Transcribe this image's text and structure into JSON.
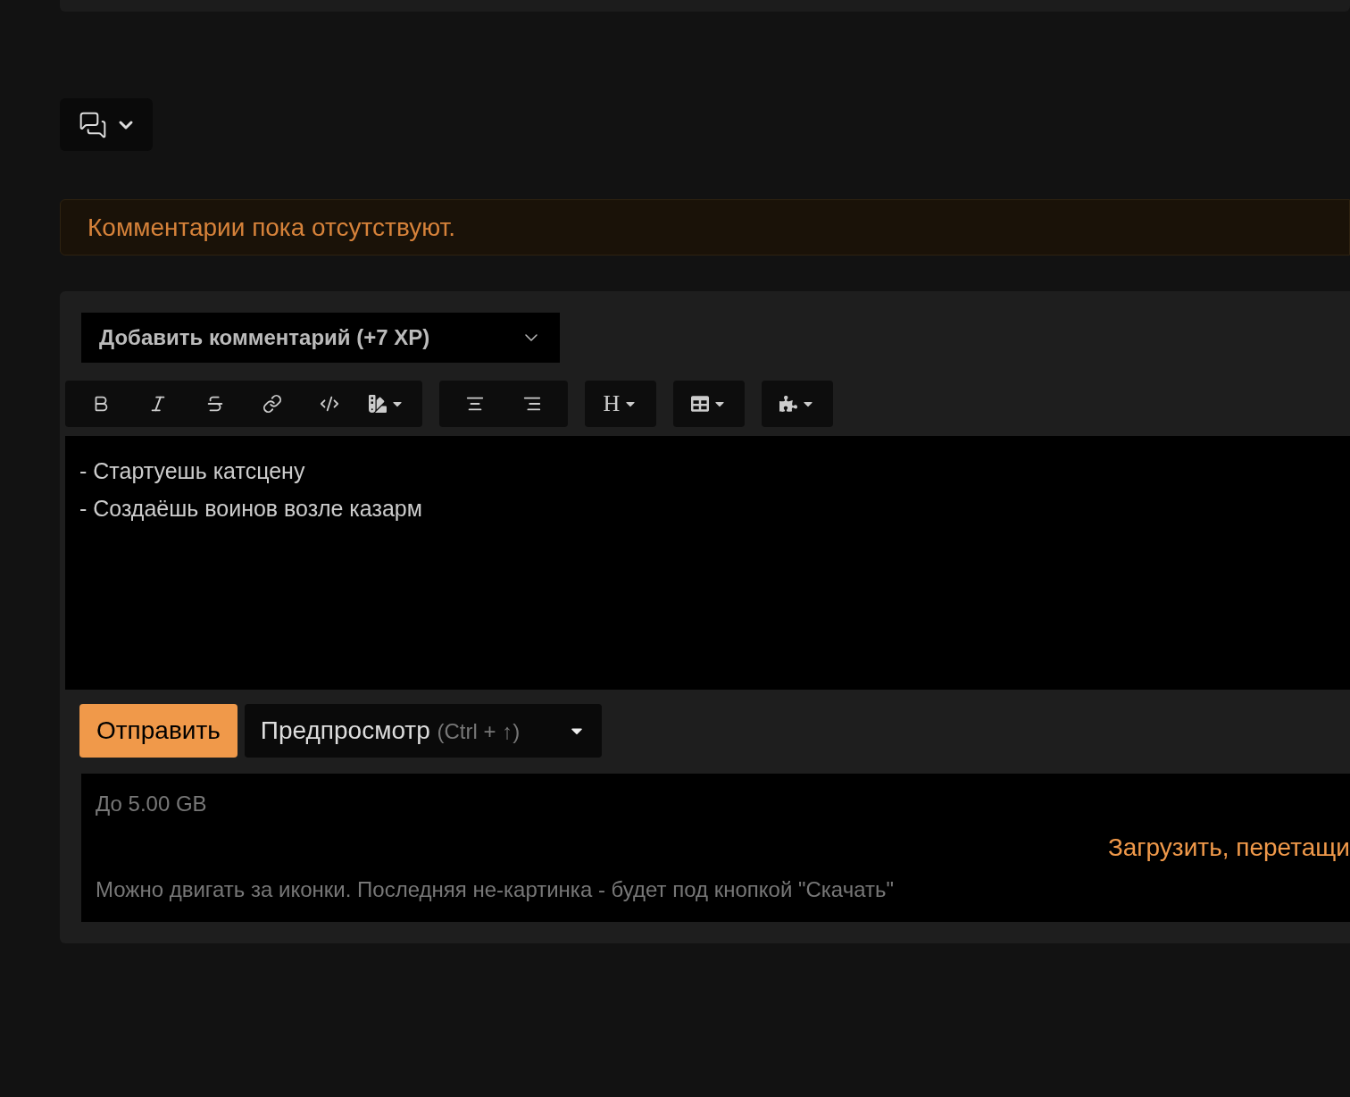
{
  "comments_toggle": {
    "menu": true
  },
  "notice": "Комментарии пока отсутствуют.",
  "form": {
    "mode_select": {
      "value": "Добавить комментарий (+7 XP)"
    },
    "toolbar": [
      {
        "buttons": [
          {
            "kind": "bold",
            "menu": false
          },
          {
            "kind": "italic",
            "menu": false
          },
          {
            "kind": "strike",
            "menu": false
          },
          {
            "kind": "link",
            "menu": false
          },
          {
            "kind": "code",
            "menu": false
          },
          {
            "kind": "color",
            "menu": true
          }
        ]
      },
      {
        "buttons": [
          {
            "kind": "center",
            "menu": false
          },
          {
            "kind": "right",
            "menu": false
          }
        ]
      },
      {
        "buttons": [
          {
            "kind": "heading",
            "label": "H",
            "menu": true
          }
        ]
      },
      {
        "buttons": [
          {
            "kind": "table",
            "menu": true
          }
        ]
      },
      {
        "buttons": [
          {
            "kind": "plugin",
            "menu": true
          }
        ]
      }
    ],
    "editor": {
      "lines": [
        "- Стартуешь катсцену",
        "- Создаёшь воинов возле казарм"
      ]
    },
    "submit": "Отправить",
    "preview": {
      "label": "Предпросмотр",
      "shortcut": "(Ctrl + ↑)",
      "menu": true
    },
    "upload": {
      "limit": "До 5.00 GB",
      "action": "Загрузить, перетащи",
      "hint": "Можно двигать за иконки. Последняя не-картинка - будет под кнопкой \"Скачать\""
    }
  }
}
